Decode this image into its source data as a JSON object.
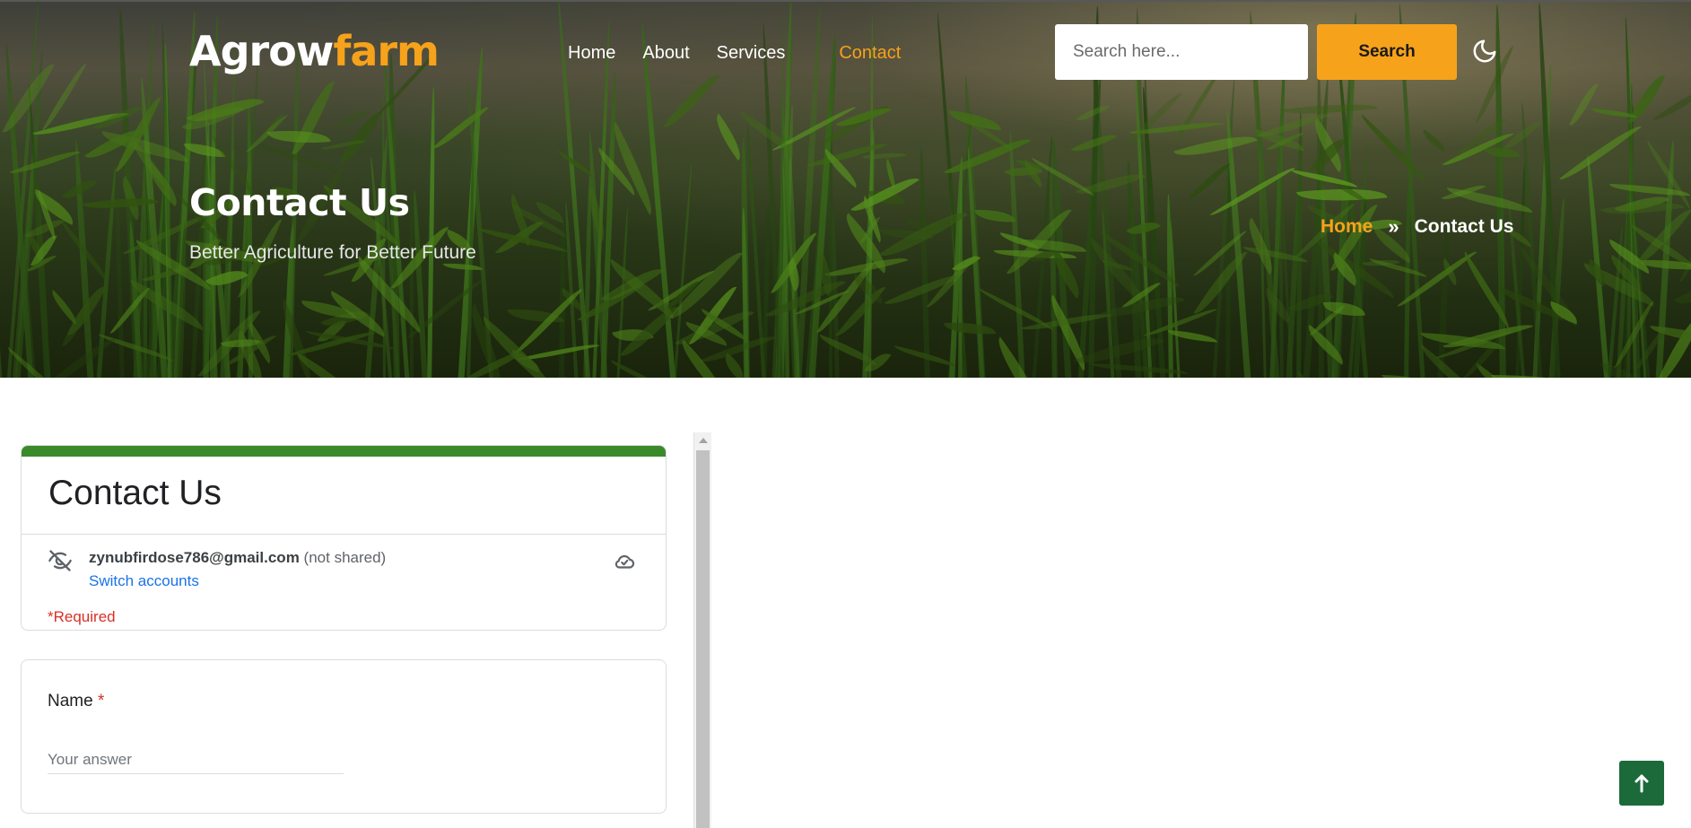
{
  "header": {
    "logo_main": "Agrow",
    "logo_accent": "farm",
    "nav": [
      {
        "label": "Home"
      },
      {
        "label": "About"
      },
      {
        "label": "Services"
      },
      {
        "label": "Contact"
      }
    ],
    "active_nav": "Contact",
    "search_placeholder": "Search here...",
    "search_button": "Search",
    "theme_icon": "moon-icon"
  },
  "hero": {
    "title": "Contact Us",
    "subtitle": "Better Agriculture for Better Future",
    "breadcrumb": {
      "home": "Home",
      "separator": "»",
      "current": "Contact Us"
    }
  },
  "form": {
    "title": "Contact Us",
    "account_email": "zynubfirdose786@gmail.com",
    "not_shared": "(not shared)",
    "switch_accounts": "Switch accounts",
    "required_note": "*Required",
    "question_label": "Name",
    "question_required_mark": "*",
    "answer_placeholder": "Your answer",
    "accent_color": "#3a8a2c"
  },
  "colors": {
    "brand_orange": "#f7a21b",
    "back_to_top_green": "#1c6a3a"
  },
  "back_to_top_icon": "arrow-up-icon"
}
